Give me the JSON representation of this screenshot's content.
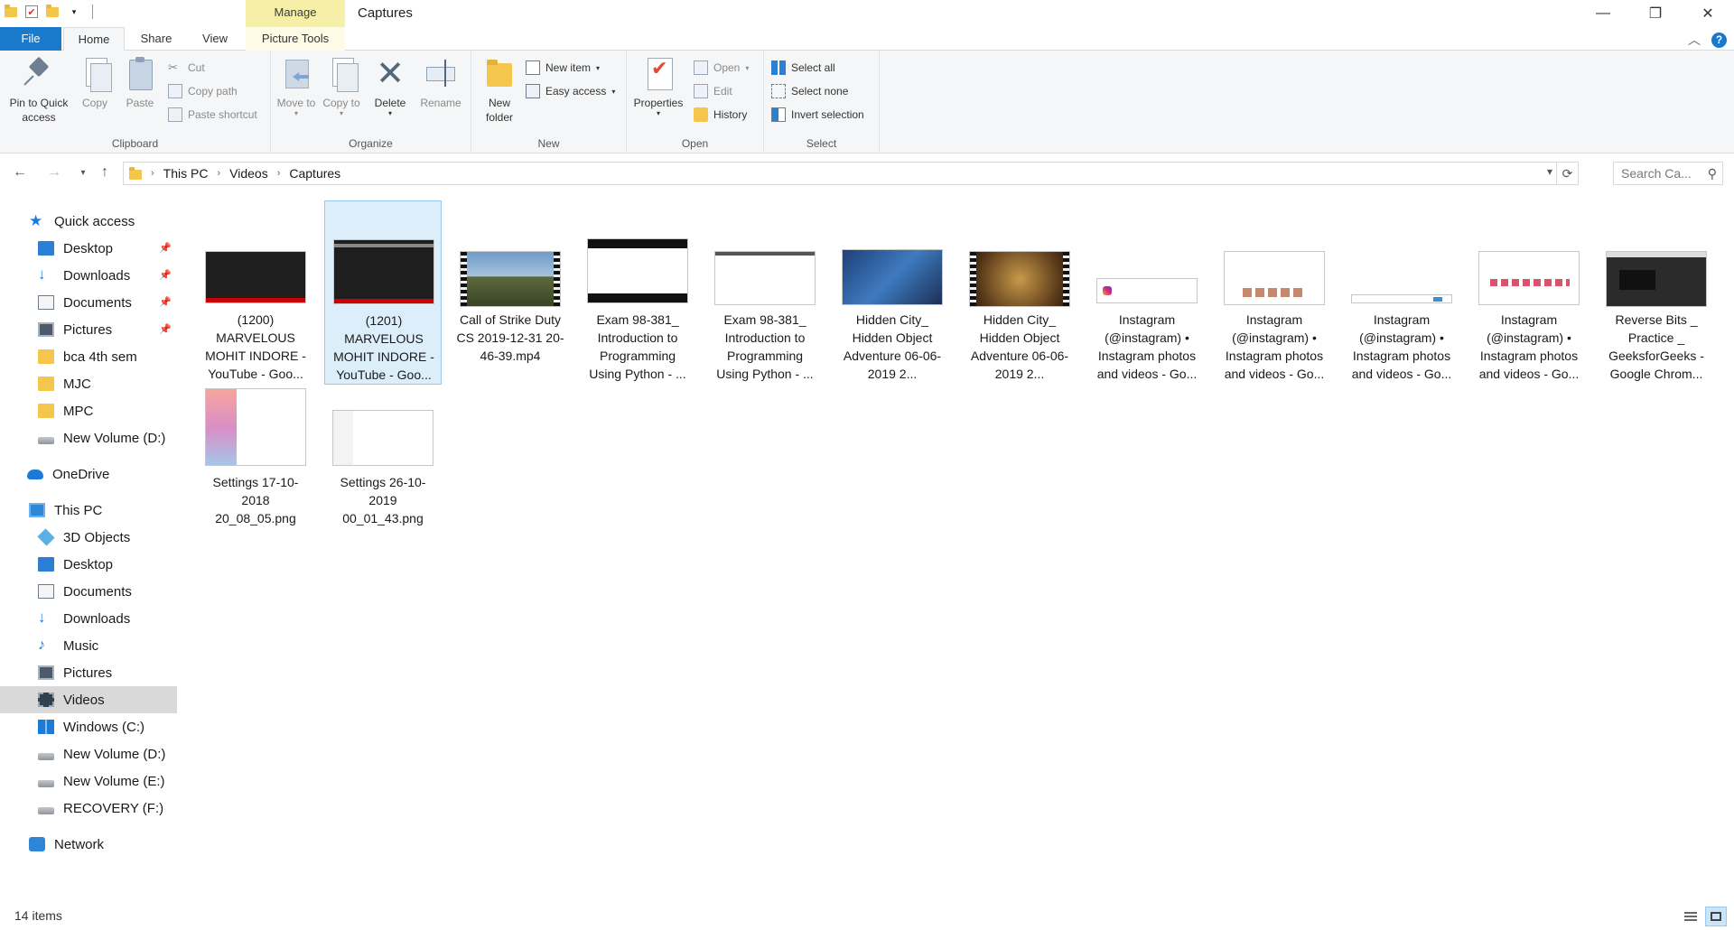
{
  "window": {
    "title": "Captures",
    "manage_label": "Manage",
    "minimize": "—",
    "restore": "❐",
    "close": "✕"
  },
  "tabs": {
    "file": "File",
    "home": "Home",
    "share": "Share",
    "view": "View",
    "picture_tools": "Picture Tools"
  },
  "ribbon": {
    "clipboard": {
      "label": "Clipboard",
      "pin": "Pin to Quick access",
      "copy": "Copy",
      "paste": "Paste",
      "cut": "Cut",
      "copy_path": "Copy path",
      "paste_shortcut": "Paste shortcut"
    },
    "organize": {
      "label": "Organize",
      "move_to": "Move to",
      "copy_to": "Copy to",
      "delete": "Delete",
      "rename": "Rename"
    },
    "new": {
      "label": "New",
      "new_folder": "New folder",
      "new_item": "New item",
      "easy_access": "Easy access"
    },
    "open": {
      "label": "Open",
      "properties": "Properties",
      "open": "Open",
      "edit": "Edit",
      "history": "History"
    },
    "select": {
      "label": "Select",
      "select_all": "Select all",
      "select_none": "Select none",
      "invert_selection": "Invert selection"
    }
  },
  "address": {
    "crumbs": [
      "This PC",
      "Videos",
      "Captures"
    ],
    "search_placeholder": "Search Ca..."
  },
  "nav": {
    "quick_access": "Quick access",
    "quick_items": [
      "Desktop",
      "Downloads",
      "Documents",
      "Pictures",
      "bca 4th sem",
      "MJC",
      "MPC",
      "New Volume (D:)"
    ],
    "onedrive": "OneDrive",
    "this_pc": "This PC",
    "pc_items": [
      "3D Objects",
      "Desktop",
      "Documents",
      "Downloads",
      "Music",
      "Pictures",
      "Videos",
      "Windows (C:)",
      "New Volume (D:)",
      "New Volume (E:)",
      "RECOVERY (F:)"
    ],
    "network": "Network"
  },
  "files": [
    {
      "name": "(1200) MARVELOUS MOHIT INDORE - YouTube - Goo...",
      "thumb": "dark"
    },
    {
      "name": "(1201) MARVELOUS MOHIT INDORE - YouTube - Goo...",
      "thumb": "dark"
    },
    {
      "name": "Call of Strike Duty CS 2019-12-31 20-46-39.mp4",
      "thumb": "game"
    },
    {
      "name": "Exam 98-381_ Introduction to Programming Using Python - ...",
      "thumb": "doc"
    },
    {
      "name": "Exam 98-381_ Introduction to Programming Using Python - ...",
      "thumb": "doc"
    },
    {
      "name": "Hidden City_ Hidden Object Adventure 06-06-2019 2...",
      "thumb": "hidden"
    },
    {
      "name": "Hidden City_ Hidden Object Adventure 06-06-2019 2...",
      "thumb": "hidden2"
    },
    {
      "name": "Instagram (@instagram) • Instagram photos and videos - Go...",
      "thumb": "insta"
    },
    {
      "name": "Instagram (@instagram) • Instagram photos and videos - Go...",
      "thumb": "insta"
    },
    {
      "name": "Instagram (@instagram) • Instagram photos and videos - Go...",
      "thumb": "insta"
    },
    {
      "name": "Instagram (@instagram) • Instagram photos and videos - Go...",
      "thumb": "insta"
    },
    {
      "name": "Reverse Bits _ Practice _ GeeksforGeeks - Google Chrom...",
      "thumb": "code"
    },
    {
      "name": "Settings 17-10-2018 20_08_05.png",
      "thumb": "settings"
    },
    {
      "name": "Settings 26-10-2019 00_01_43.png",
      "thumb": "settings2"
    }
  ],
  "status": {
    "item_count": "14 items"
  }
}
